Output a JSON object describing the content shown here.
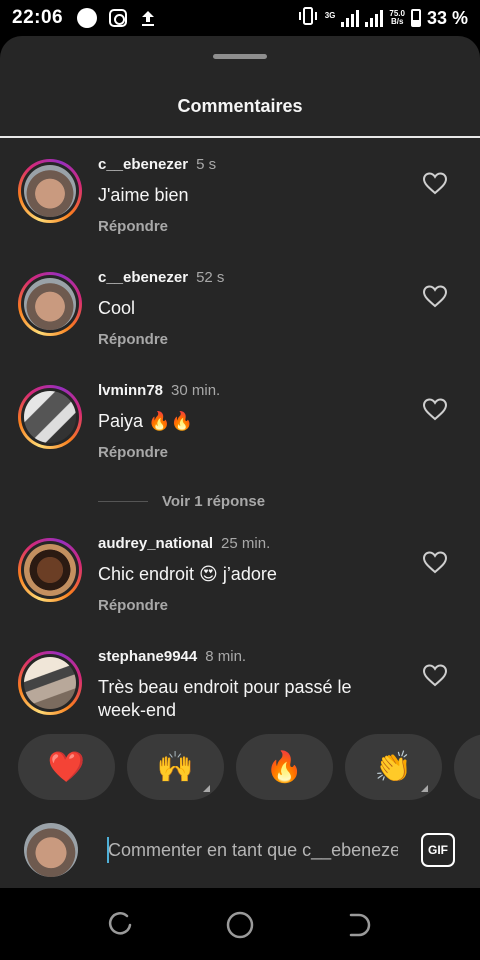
{
  "status_bar": {
    "time": "22:06",
    "network": "3G",
    "speed_value": "75.0",
    "speed_unit": "B/s",
    "battery": "33 %"
  },
  "sheet": {
    "title": "Commentaires"
  },
  "comments": [
    {
      "user": "c__ebenezer",
      "time": "5 s",
      "text": "J'aime bien",
      "reply": "Répondre",
      "avatar": "man-selfie"
    },
    {
      "user": "c__ebenezer",
      "time": "52 s",
      "text": "Cool",
      "reply": "Répondre",
      "avatar": "man-selfie"
    },
    {
      "user": "lvminn78",
      "time": "30 min.",
      "text": "Paiya 🔥🔥",
      "reply": "Répondre",
      "avatar": "group-photo"
    },
    {
      "user": "audrey_national",
      "time": "25 min.",
      "text": "Chic endroit 😍 j’adore",
      "reply": "Répondre",
      "avatar": "woman-portrait"
    },
    {
      "user": "stephane9944",
      "time": "8 min.",
      "text": "Très beau endroit pour passé le week-end",
      "avatar": "group-photo-2"
    }
  ],
  "view_replies": "Voir 1 réponse",
  "reactions": [
    "❤️",
    "🙌",
    "🔥",
    "👏"
  ],
  "composer": {
    "placeholder": "Commenter en tant que c__ebenezer...",
    "gif_label": "GIF"
  },
  "icons": {
    "like": "heart-outline-icon",
    "gif": "gif-icon",
    "nav": [
      "recents-icon",
      "home-icon",
      "back-icon"
    ]
  },
  "colors": {
    "sheet_bg": "#262626",
    "secondary_text": "#a8a8a8",
    "reaction_bg": "#3a3a3a"
  }
}
